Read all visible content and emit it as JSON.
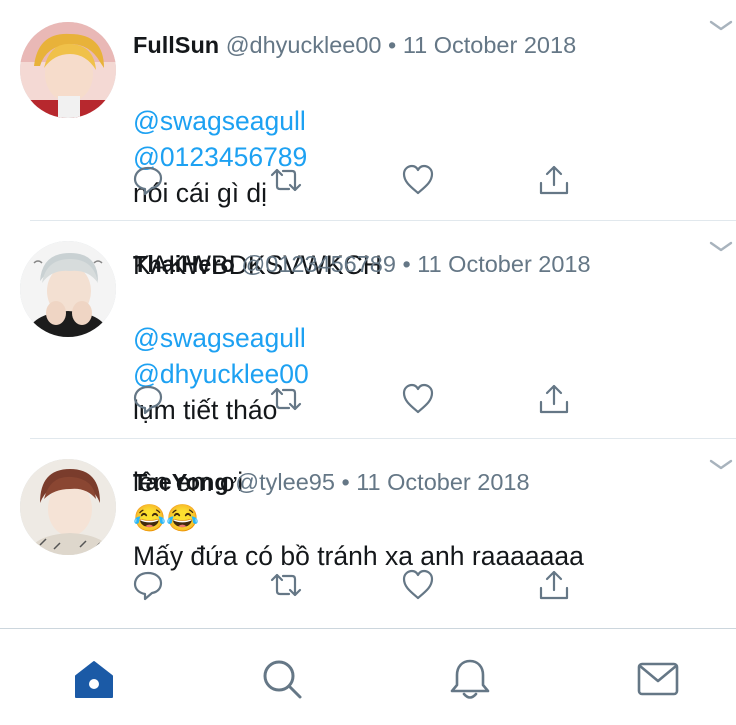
{
  "theme": {
    "accent": "#1da1f2",
    "text": "#14171a",
    "muted": "#657786",
    "icon": "#657786",
    "tab_active": "#1b5aa6",
    "tab_inactive": "#657786"
  },
  "tweets": [
    {
      "name": "FullSun",
      "handle": "@dhyucklee00",
      "separator": "•",
      "date": "11 October 2018",
      "mention_1": "@swagseagull",
      "mention_2": "@0123456789",
      "body": "nói cái gì dị",
      "body_line2": "KAKWBDKSVWKCH",
      "emoji": ""
    },
    {
      "name": "ThaiHero",
      "handle": "@0123456789",
      "separator": "•",
      "date": "11 October 2018",
      "mention_1": "@swagseagull",
      "mention_2": "@dhyucklee00",
      "body": "lụm tiết tháo",
      "body_line2": "lên em ơi",
      "emoji": "😂😂"
    },
    {
      "name": "TaeYong",
      "handle": "@tylee95",
      "separator": "•",
      "date": "11 October 2018",
      "body": "Mấy đứa có bồ tránh xa anh raaaaaaa"
    }
  ],
  "action_icons": [
    "reply-icon",
    "retweet-icon",
    "like-icon",
    "share-icon"
  ],
  "tab_icons": [
    "home-icon",
    "search-icon",
    "notifications-icon",
    "messages-icon"
  ],
  "active_tab": "home"
}
